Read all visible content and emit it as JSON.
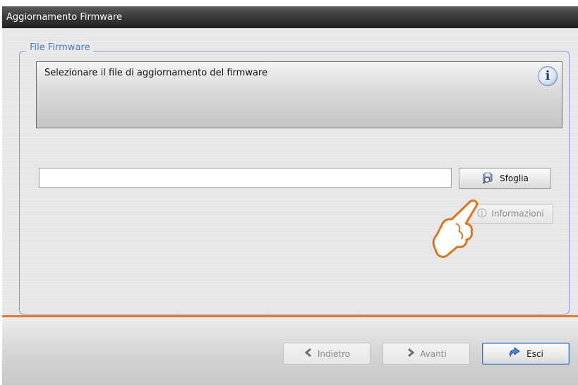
{
  "window": {
    "title": "Aggiornamento Firmware"
  },
  "group": {
    "legend": "File Firmware",
    "info_text": "Selezionare il file di aggiornamento del firmware",
    "info_icon": "info-icon"
  },
  "file_input": {
    "value": "",
    "placeholder": ""
  },
  "buttons": {
    "browse": "Sfoglia",
    "info": "Informazioni",
    "back": "Indietro",
    "next": "Avanti",
    "exit": "Esci"
  },
  "icons": {
    "browse": "folder-search-icon",
    "info": "info-icon",
    "back": "chevron-left-icon",
    "next": "chevron-right-icon",
    "exit": "exit-icon",
    "pointer": "hand-pointer-icon"
  },
  "colors": {
    "accent_orange": "#e8772c",
    "group_border": "#7aa3d6",
    "title_bar": "#2b2b2b"
  }
}
